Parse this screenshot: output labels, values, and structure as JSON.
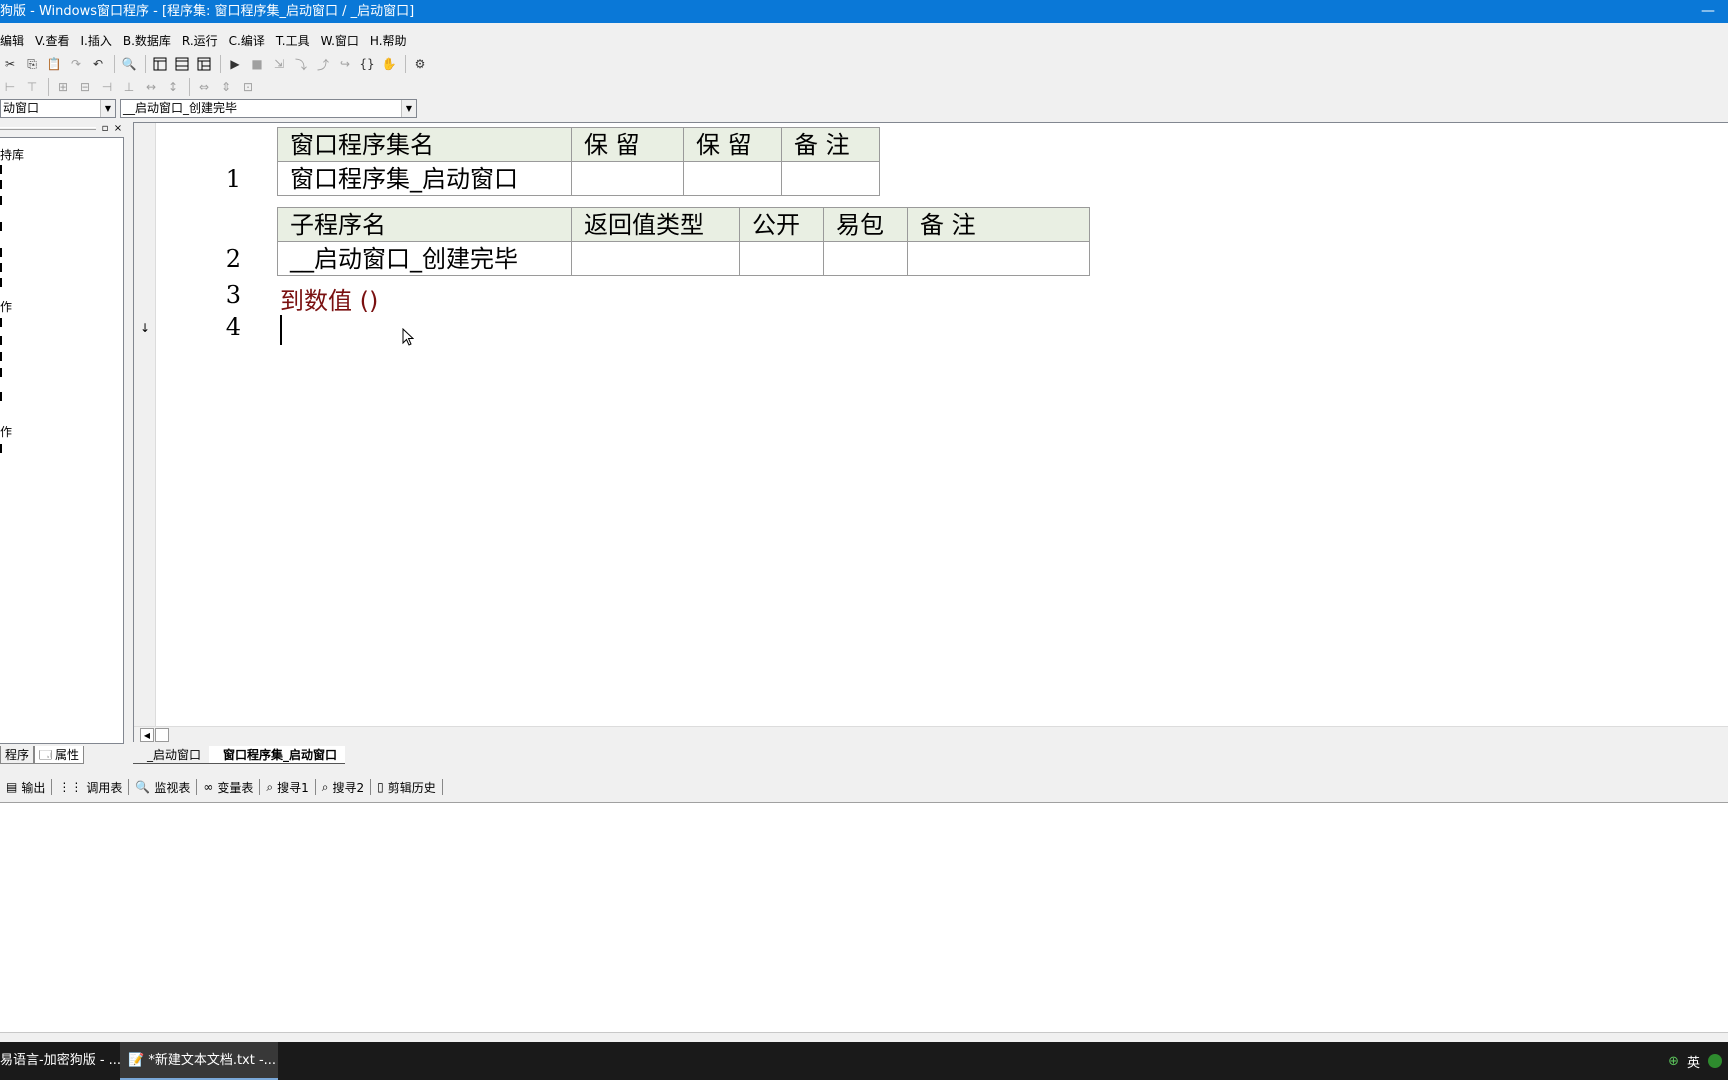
{
  "window": {
    "title": "狗版 - Windows窗口程序 - [程序集: 窗口程序集_启动窗口 / _启动窗口]",
    "minimize_glyph": "—"
  },
  "menu": [
    "编辑",
    "V.查看",
    "I.插入",
    "B.数据库",
    "R.运行",
    "C.编译",
    "T.工具",
    "W.窗口",
    "H.帮助"
  ],
  "toolbar": {
    "icons": [
      "cut-icon",
      "copy-icon",
      "paste-icon",
      "redo-icon",
      "undo-icon",
      "find-icon",
      "layout1-icon",
      "layout2-icon",
      "layout3-icon",
      "run-icon",
      "stop-icon",
      "step-icon",
      "step-in-icon",
      "step-out-icon",
      "step-over-icon",
      "brace-icon",
      "hand-icon",
      "debug-icon"
    ]
  },
  "combos": {
    "left_value": "动窗口",
    "right_value": "__启动窗口_创建完毕"
  },
  "left_panel": {
    "pin_glyph": "▫",
    "close_glyph": "×",
    "nodes": [
      "持库",
      "作",
      "作"
    ],
    "tabs": [
      "程序",
      "属性"
    ]
  },
  "editor": {
    "assembly_table": {
      "headers": [
        "窗口程序集名",
        "保 留",
        "保 留",
        "备 注"
      ],
      "row": [
        "窗口程序集_启动窗口",
        "",
        "",
        ""
      ],
      "line": "1"
    },
    "sub_table": {
      "headers": [
        "子程序名",
        "返回值类型",
        "公开",
        "易包",
        "备 注"
      ],
      "row": [
        "__启动窗口_创建完毕",
        "",
        "",
        "",
        ""
      ],
      "line": "2"
    },
    "lines": [
      {
        "num": "3",
        "code": "到数值 ()"
      },
      {
        "num": "4",
        "code": ""
      }
    ],
    "gutter_mark": "↓"
  },
  "file_tabs": [
    "_启动窗口",
    "窗口程序集_启动窗口"
  ],
  "bottom_tabs": [
    "输出",
    "调用表",
    "监视表",
    "变量表",
    "搜寻1",
    "搜寻2",
    "剪辑历史"
  ],
  "taskbar": {
    "tasks": [
      "易语言-加密狗版 - ...",
      "*新建文本文档.txt -..."
    ],
    "ime": "英"
  }
}
